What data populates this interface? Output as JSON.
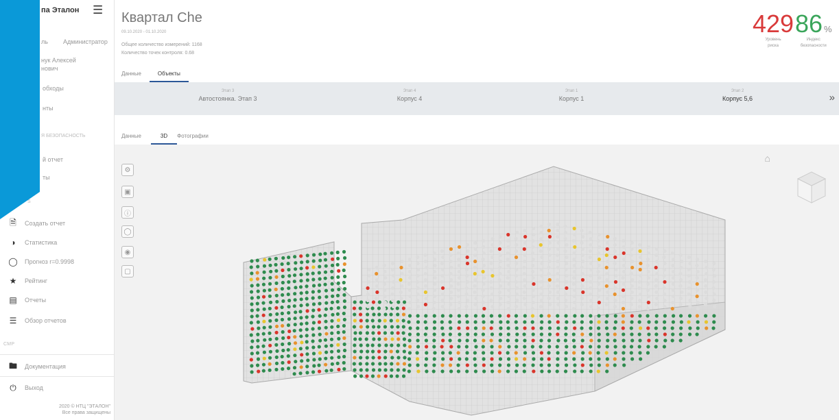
{
  "sidebar": {
    "brand": "па Эталон",
    "user_left": "ль",
    "user_role": "Администратор",
    "user_name1": "нук Алексей",
    "user_name2": "нович",
    "item_a": "обходы",
    "item_b": "нты",
    "section_safety": "Я БЕЗОПАСНОСТЬ",
    "item_c": "й отчет",
    "item_d": "ты",
    "section_blank": "S",
    "items": [
      {
        "label": "Создать отчет",
        "icon": "file-plus-icon"
      },
      {
        "label": "Статистика",
        "icon": "pie-chart-icon"
      },
      {
        "label": "Прогноз r=0.9998",
        "icon": "forecast-icon"
      },
      {
        "label": "Рейтинг",
        "icon": "star-icon"
      },
      {
        "label": "Отчеты",
        "icon": "report-icon"
      },
      {
        "label": "Обзор отчетов",
        "icon": "list-icon"
      }
    ],
    "section_smp": "СМР",
    "docs": "Документация",
    "logout": "Выход",
    "footer1": "2020 © НТЦ \"ЭТАЛОН\"",
    "footer2": "Все права защищены"
  },
  "header": {
    "title": "Квартал Che",
    "dates": "09.10.2020 - 01.10.2020",
    "info1": "Общее количество измерений: 1168",
    "info2": "Количество точек контроля: 0.68",
    "risk_value": "429",
    "risk_caption1": "Уровень",
    "risk_caption2": "риска",
    "safety_value": "86",
    "safety_unit": "%",
    "safety_caption1": "Индекс",
    "safety_caption2": "безопасности"
  },
  "tabs_top": [
    "Данные",
    "Объекты"
  ],
  "stages": [
    {
      "small": "Этап 3",
      "name": "Автостоянка. Этап 3"
    },
    {
      "small": "Этап 4",
      "name": "Корпус 4"
    },
    {
      "small": "Этап 1",
      "name": "Корпус 1"
    },
    {
      "small": "Этап 2",
      "name": "Корпус 5,6"
    }
  ],
  "tabs_view": [
    "Данные",
    "3D",
    "Фотографии"
  ],
  "colors": {
    "risk": "#d93a3a",
    "safety": "#3aa55a",
    "accent": "#2b5797",
    "corner": "#0a99d8"
  }
}
